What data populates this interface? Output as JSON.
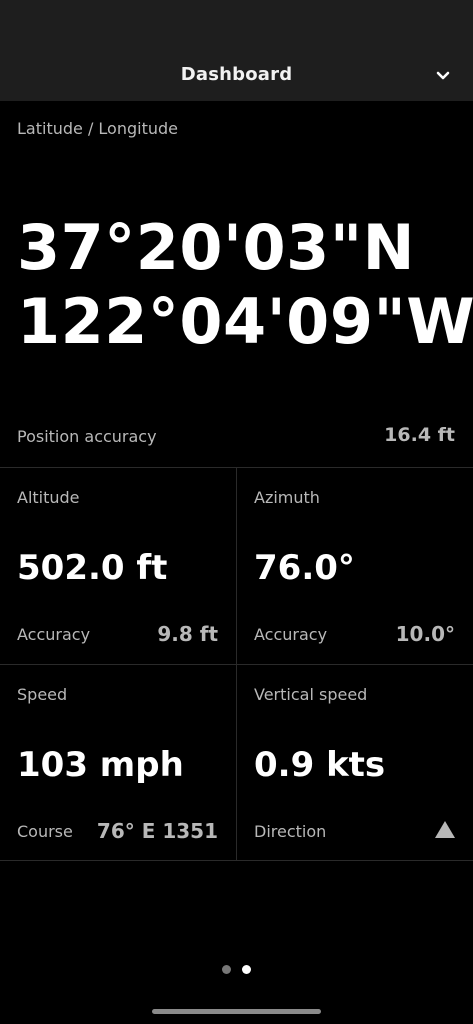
{
  "header": {
    "title": "Dashboard",
    "chevron_icon": "chevron-down-icon"
  },
  "position": {
    "label": "Latitude / Longitude",
    "latitude": "37°20'03\"N",
    "longitude": "122°04'09\"W",
    "accuracy_label": "Position accuracy",
    "accuracy_value": "16.4 ft"
  },
  "altitude": {
    "label": "Altitude",
    "value": "502.0 ft",
    "sublabel": "Accuracy",
    "subvalue": "9.8 ft"
  },
  "azimuth": {
    "label": "Azimuth",
    "value": "76.0°",
    "sublabel": "Accuracy",
    "subvalue": "10.0°"
  },
  "speed": {
    "label": "Speed",
    "value": "103 mph",
    "sublabel": "Course",
    "subvalue": "76° E 1351"
  },
  "vertical_speed": {
    "label": "Vertical speed",
    "value": "0.9 kts",
    "sublabel": "Direction",
    "direction_icon": "triangle-up-icon"
  },
  "pager": {
    "count": 2,
    "active": 2
  }
}
